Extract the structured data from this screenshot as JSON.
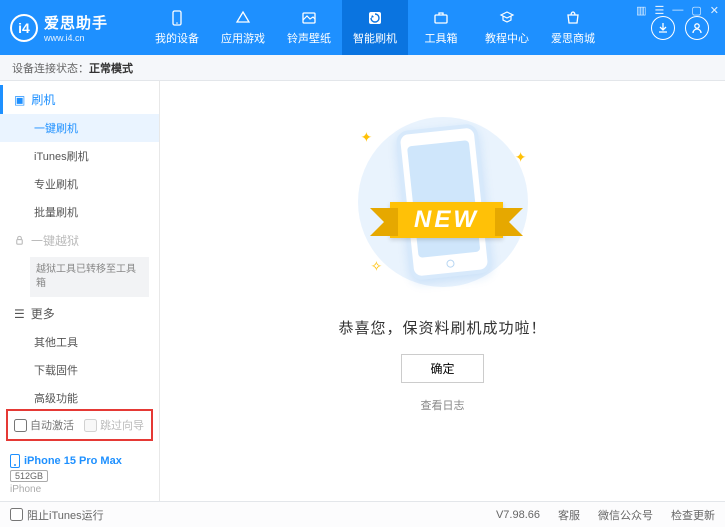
{
  "header": {
    "app_name": "爱思助手",
    "app_url": "www.i4.cn",
    "nav": [
      {
        "label": "我的设备"
      },
      {
        "label": "应用游戏"
      },
      {
        "label": "铃声壁纸"
      },
      {
        "label": "智能刷机"
      },
      {
        "label": "工具箱"
      },
      {
        "label": "教程中心"
      },
      {
        "label": "爱思商城"
      }
    ],
    "window_ctrl_settings": "☰",
    "window_ctrl_min": "—",
    "window_ctrl_max": "▢",
    "window_ctrl_close": "✕",
    "cart_icon": "▥"
  },
  "status": {
    "label": "设备连接状态：",
    "value": "正常模式"
  },
  "sidebar": {
    "group_flash_icon": "▣",
    "group_flash": "刷机",
    "items_flash": [
      "一键刷机",
      "iTunes刷机",
      "专业刷机",
      "批量刷机"
    ],
    "group_jailbreak": "一键越狱",
    "jailbreak_note": "越狱工具已转移至工具箱",
    "group_more_icon": "☰",
    "group_more": "更多",
    "items_more": [
      "其他工具",
      "下载固件",
      "高级功能"
    ],
    "cb_auto_activate": "自动激活",
    "cb_skip_guide": "跳过向导"
  },
  "device": {
    "name": "iPhone 15 Pro Max",
    "storage": "512GB",
    "type": "iPhone"
  },
  "main": {
    "ribbon_text": "NEW",
    "success_msg": "恭喜您，保资料刷机成功啦！",
    "ok_btn": "确定",
    "view_log": "查看日志"
  },
  "footer": {
    "block_itunes": "阻止iTunes运行",
    "version": "V7.98.66",
    "links": [
      "客服",
      "微信公众号",
      "检查更新"
    ]
  }
}
